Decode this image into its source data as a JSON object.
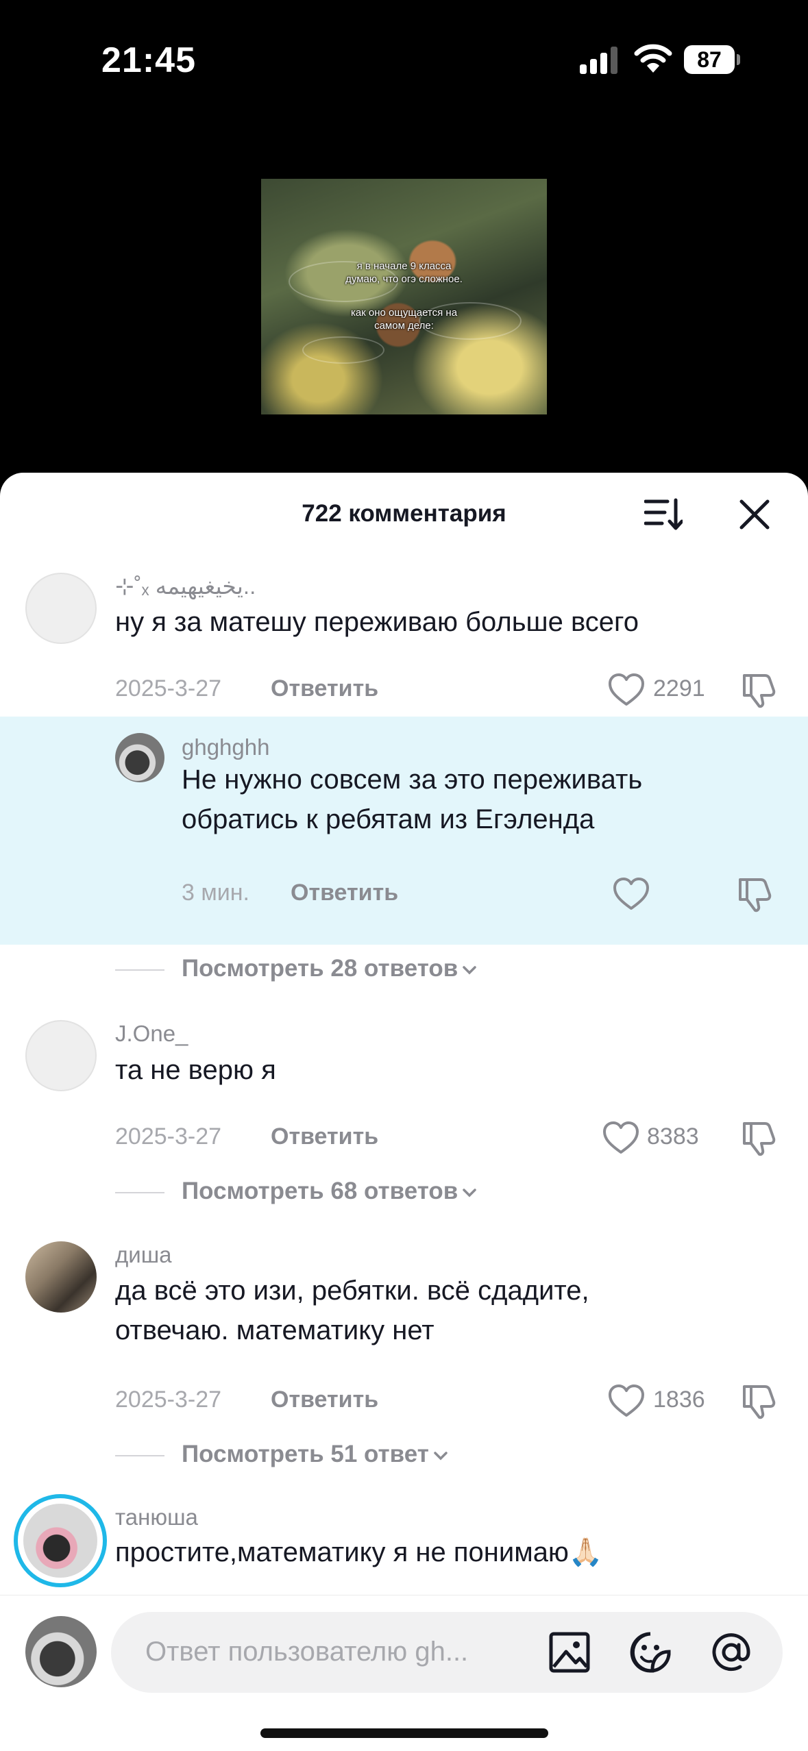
{
  "status": {
    "time": "21:45",
    "battery": "87"
  },
  "video": {
    "caption_1": "я в начале 9 класса",
    "caption_2": "думаю, что огэ сложное.",
    "caption_3": "как оно ощущается на",
    "caption_4": "самом деле:"
  },
  "sheet": {
    "title": "722 комментария"
  },
  "comments": [
    {
      "username": "⊹˚ₓ يخيغيهيمه..",
      "text": "ну я за матешу переживаю больше всего",
      "date": "2025-3-27",
      "reply_label": "Ответить",
      "likes": "2291"
    },
    {
      "username": "J.One_",
      "text": "та не верю я",
      "date": "2025-3-27",
      "reply_label": "Ответить",
      "likes": "8383",
      "view_replies": "Посмотреть 68 ответов"
    },
    {
      "username": "диша",
      "text_1": "да всё это изи, ребятки. всё сдадите,",
      "text_2": "отвечаю. математику нет",
      "date": "2025-3-27",
      "reply_label": "Ответить",
      "likes": "1836",
      "view_replies": "Посмотреть 51 ответ"
    },
    {
      "username": "танюша",
      "text": "простите,математику я не понимаю🙏🏻"
    }
  ],
  "reply": {
    "username": "ghghghh",
    "text_1": "Не нужно совсем за это переживать",
    "text_2": "обратись к ребятам из Егэленда",
    "time": "3 мин.",
    "reply_label": "Ответить",
    "view_replies": "Посмотреть 28 ответов"
  },
  "input": {
    "placeholder": "Ответ пользователю gh..."
  },
  "colors": {
    "highlight": "#e3f6fb",
    "story_ring": "#1fb8e8"
  }
}
